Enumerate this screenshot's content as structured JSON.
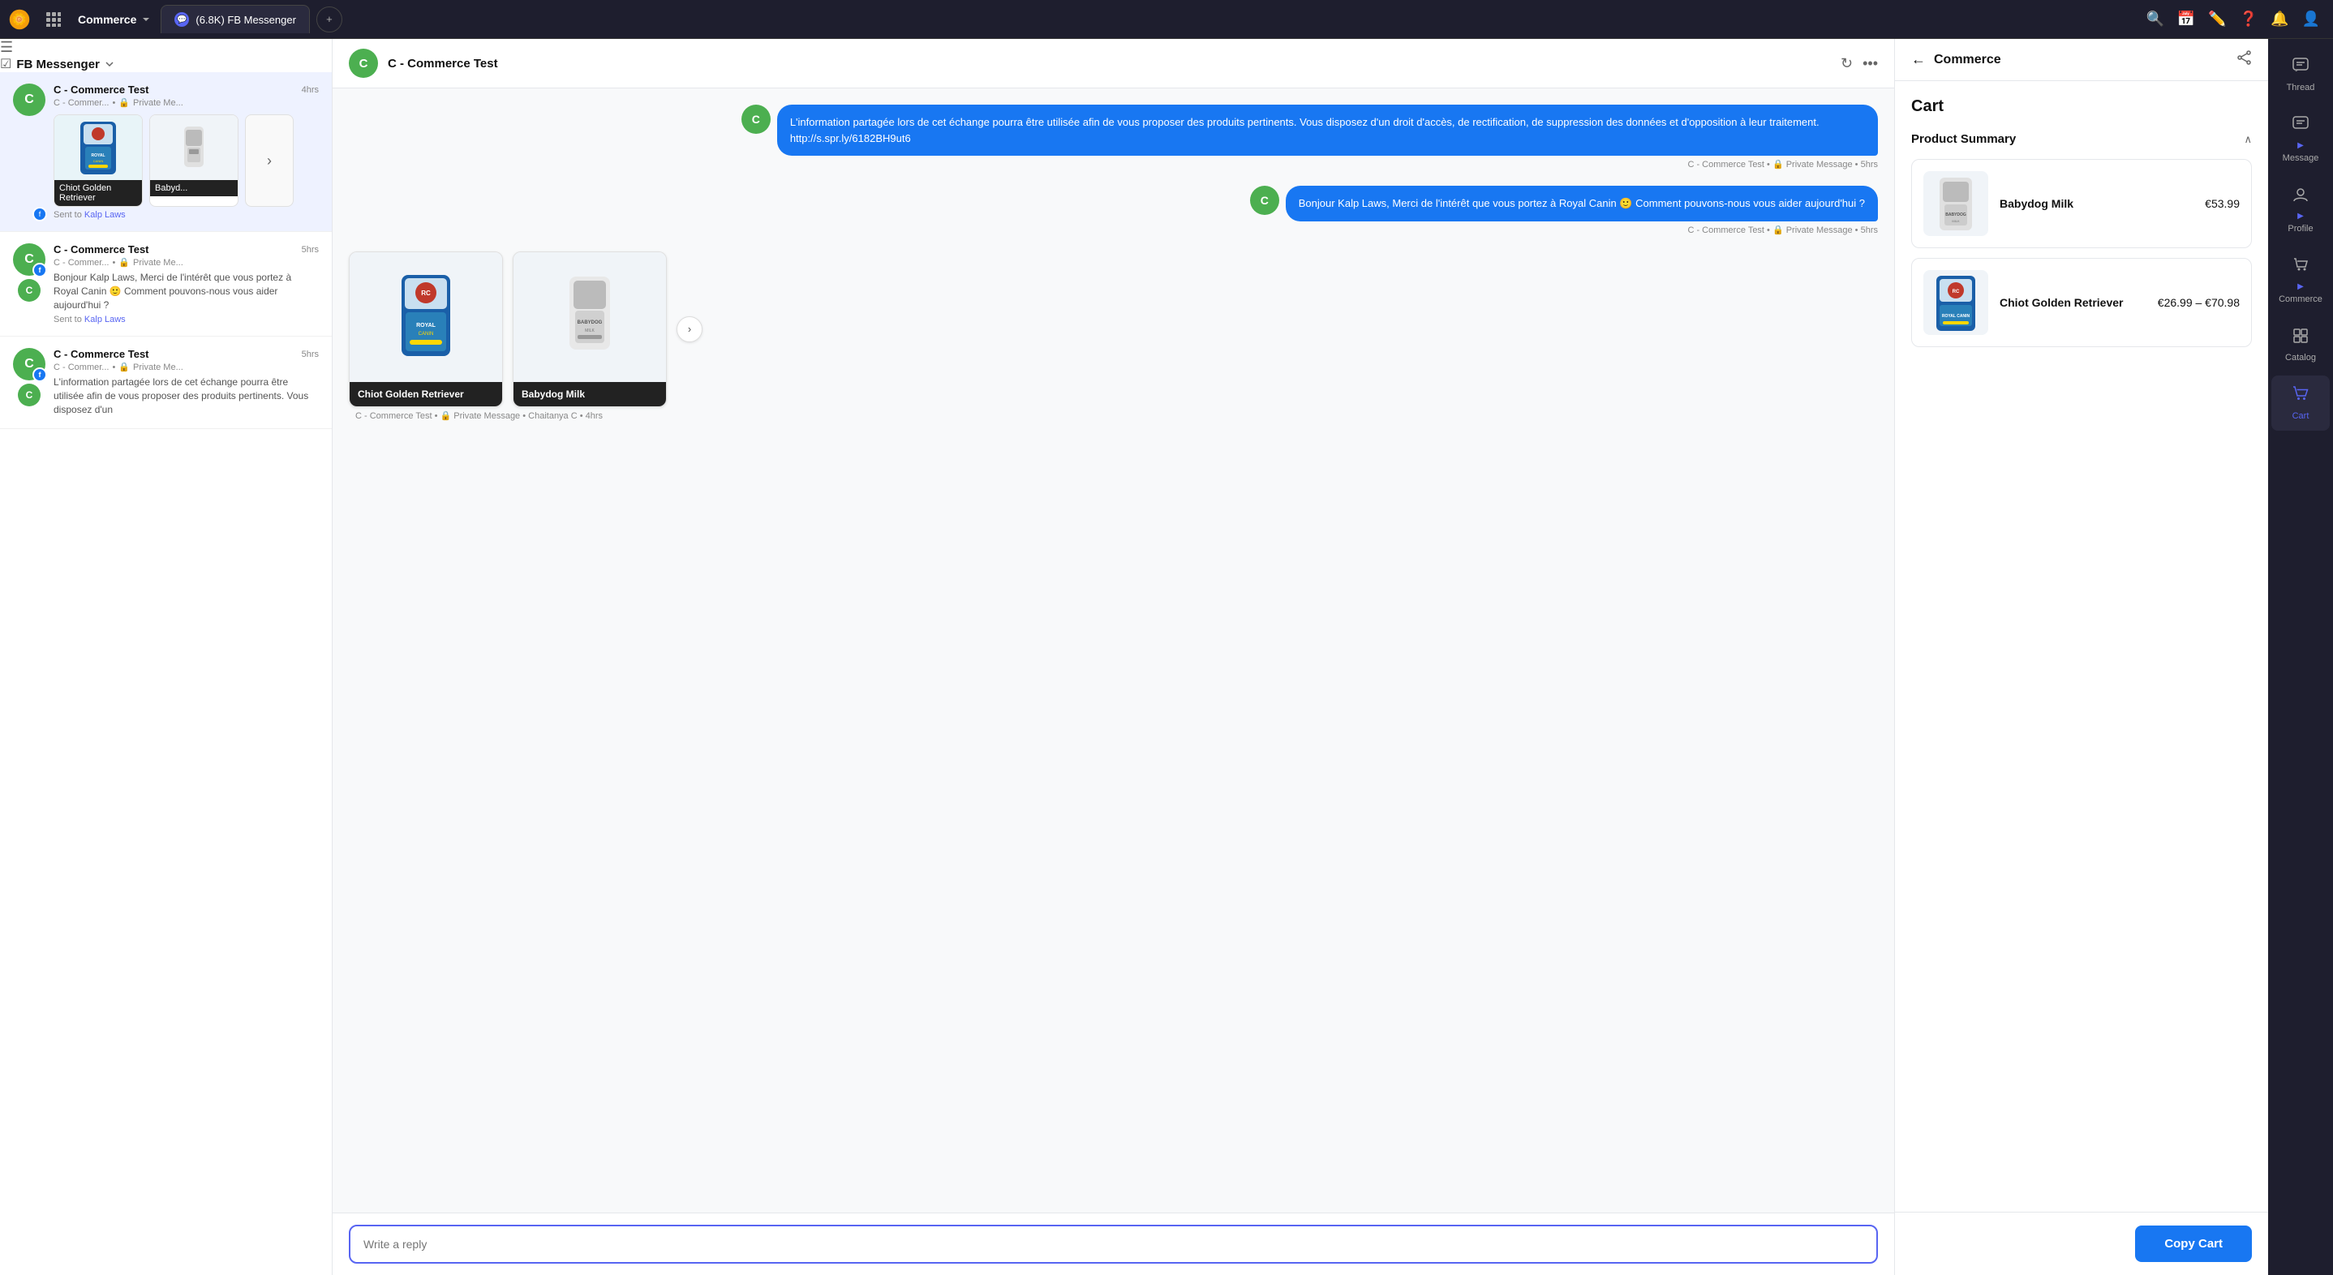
{
  "topbar": {
    "logo_text": "🌼",
    "workspace": "Commerce",
    "tab_label": "(6.8K) FB Messenger",
    "tab_icon": "💬"
  },
  "left_sidebar": {
    "inbox_label": "FB Messenger",
    "conversations": [
      {
        "id": "conv1",
        "name": "C - Commerce Test",
        "time": "4hrs",
        "meta_source": "C - Commer...",
        "meta_privacy": "Private Me...",
        "has_products": true,
        "products": [
          {
            "name": "Chiot Golden Retriever"
          },
          {
            "name": "Babyd..."
          }
        ],
        "sent_to": "Kalp Laws",
        "avatar_letter": "C",
        "sub_avatar": "f"
      },
      {
        "id": "conv2",
        "name": "C - Commerce Test",
        "time": "5hrs",
        "meta_source": "C - Commer...",
        "meta_privacy": "Private Me...",
        "preview": "Bonjour Kalp Laws, Merci de l'intérêt que vous portez à Royal Canin 🙂 Comment pouvons-nous vous aider aujourd'hui ?",
        "sent_to": "Kalp Laws",
        "avatar_letter": "C",
        "sub_avatar": "f",
        "inner_avatar": "C"
      },
      {
        "id": "conv3",
        "name": "C - Commerce Test",
        "time": "5hrs",
        "meta_source": "C - Commer...",
        "meta_privacy": "Private Me...",
        "preview": "L'information partagée lors de cet échange pourra être utilisée afin de vous proposer des produits pertinents. Vous disposez d'un",
        "avatar_letter": "C",
        "sub_avatar": "f",
        "inner_avatar": "C"
      }
    ]
  },
  "chat": {
    "contact_name": "C - Commerce Test",
    "contact_avatar": "C",
    "messages": [
      {
        "id": "msg1",
        "type": "out",
        "text": "L'information partagée lors de cet échange pourra être utilisée afin de vous proposer des produits pertinents. Vous disposez d'un droit d'accès, de rectification, de suppression des données et d'opposition à leur traitement. http://s.spr.ly/6182BH9ut6",
        "meta": "C - Commerce Test • 🔒 Private Message • 5hrs"
      },
      {
        "id": "msg2",
        "type": "out",
        "text": "Bonjour Kalp Laws, Merci de l'intérêt que vous portez à Royal Canin 🙂 Comment pouvons-nous vous aider aujourd'hui ?",
        "meta": "C - Commerce Test • 🔒 Private Message • 5hrs"
      },
      {
        "id": "msg3",
        "type": "in",
        "is_products": true,
        "products": [
          {
            "name": "Chiot Golden Retriever"
          },
          {
            "name": "Babydog Milk"
          }
        ],
        "meta": "C - Commerce Test • 🔒 Private Message • Chaitanya C • 4hrs"
      }
    ],
    "reply_placeholder": "Write a reply"
  },
  "right_panel": {
    "title": "Commerce",
    "cart_title": "Cart",
    "product_summary_label": "Product Summary",
    "products": [
      {
        "name": "Babydog Milk",
        "price": "€53.99"
      },
      {
        "name": "Chiot Golden Retriever",
        "price": "€26.99 – €70.98"
      }
    ],
    "copy_cart_label": "Copy Cart"
  },
  "rail": {
    "items": [
      {
        "label": "Thread",
        "icon": "💬",
        "active": false
      },
      {
        "label": "Message",
        "icon": "✉️",
        "active": false
      },
      {
        "label": "Profile",
        "icon": "👤",
        "active": false
      },
      {
        "label": "Commerce",
        "icon": "🏪",
        "active": false
      },
      {
        "label": "Catalog",
        "icon": "📋",
        "active": false
      },
      {
        "label": "Cart",
        "icon": "🛒",
        "active": true
      }
    ]
  }
}
